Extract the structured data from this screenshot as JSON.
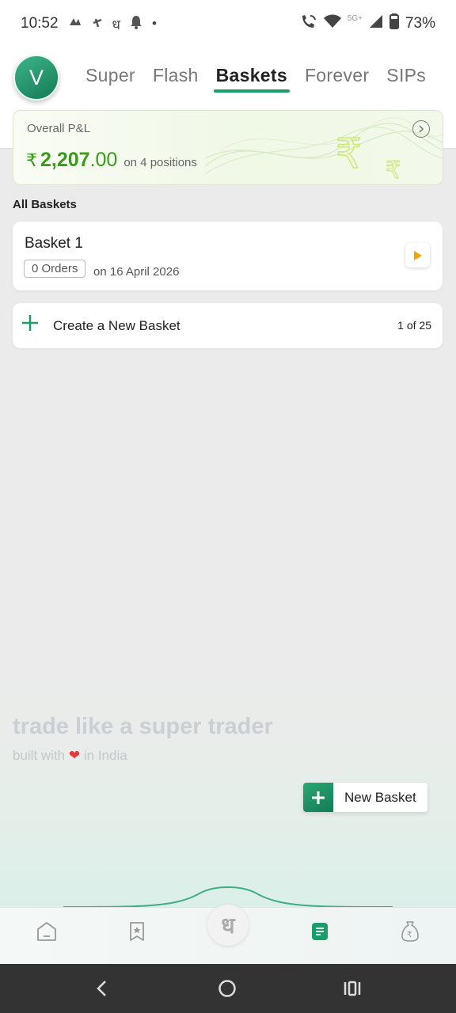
{
  "status_bar": {
    "time": "10:52",
    "hindi_glyph": "ध",
    "dot": "•",
    "network_label": "5G+",
    "battery": "73%"
  },
  "header": {
    "avatar_letter": "V",
    "tabs": [
      {
        "label": "Super",
        "active": false
      },
      {
        "label": "Flash",
        "active": false
      },
      {
        "label": "Baskets",
        "active": true
      },
      {
        "label": "Forever",
        "active": false
      },
      {
        "label": "SIPs",
        "active": false
      }
    ]
  },
  "pnl": {
    "title": "Overall P&L",
    "currency": "₹",
    "amount_main": "2,207",
    "amount_decimal": ".00",
    "positions": "on 4 positions"
  },
  "baskets": {
    "section_title": "All Baskets",
    "items": [
      {
        "name": "Basket 1",
        "orders": "0 Orders",
        "date": "on 16 April 2026"
      }
    ],
    "create_label": "Create a New Basket",
    "count": "1 of 25"
  },
  "footer_brand": {
    "tagline": "trade like a super trader",
    "built_with": "built with",
    "heart": "❤",
    "in_india": "in India"
  },
  "fab": {
    "plus": "+",
    "label": "New Basket"
  },
  "bottom_nav": {
    "center_glyph": "ध",
    "items": [
      "home-icon",
      "watchlist-icon",
      "logo",
      "baskets-icon",
      "funds-icon"
    ]
  },
  "colors": {
    "brand_green": "#1a9d6b",
    "profit_green": "#3a9a1a",
    "play_orange": "#f0a500"
  }
}
